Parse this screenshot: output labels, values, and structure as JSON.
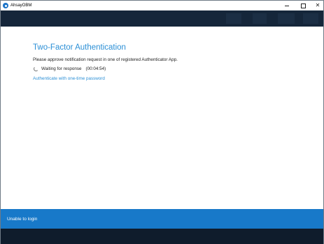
{
  "window": {
    "title": "AhsayOBM"
  },
  "main": {
    "heading": "Two-Factor Authentication",
    "description": "Please approve notification request in one of registered Authenticator App.",
    "status_label": "Waiting for response",
    "status_timer": "(00:04:54)",
    "otp_link": "Authenticate with one-time password"
  },
  "footer": {
    "unable_link": "Unable to login"
  },
  "colors": {
    "accent": "#2b8fd6",
    "footer_bar": "#1879c9",
    "background_dark": "#0e1d2e"
  },
  "icons": {
    "app": "ahsay-logo-icon",
    "spinner": "loading-spinner-icon",
    "minimize": "minimize-icon",
    "maximize": "maximize-icon",
    "close": "close-icon"
  }
}
